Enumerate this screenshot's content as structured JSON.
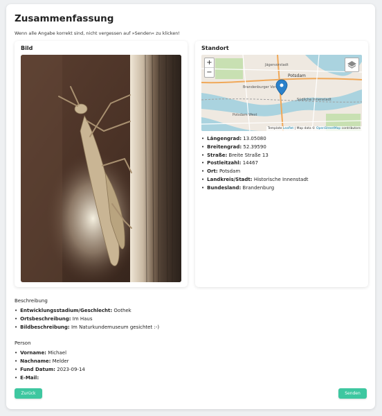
{
  "page": {
    "title": "Zusammenfassung",
    "subtitle": "Wenn alle Angabe korrekt sind, nicht vergessen auf »Senden« zu klicken!"
  },
  "image_card": {
    "title": "Bild"
  },
  "location_card": {
    "title": "Standort",
    "map": {
      "zoom_in": "+",
      "zoom_out": "−",
      "attribution_prefix": "Template",
      "attribution_leaflet": "Leaflet",
      "attribution_sep": " | Map data © ",
      "attribution_osm": "OpenStreetMap",
      "attribution_suffix": " contributors",
      "labels": [
        "Jägervorstadt",
        "Potsdam",
        "Brandenburger Vorstadt",
        "Potsdam West",
        "Südliche Innenstadt"
      ]
    },
    "fields": [
      {
        "label": "Längengrad:",
        "value": "13.05080"
      },
      {
        "label": "Breitengrad:",
        "value": "52.39590"
      },
      {
        "label": "Straße:",
        "value": "Breite Straße 13"
      },
      {
        "label": "Postleitzahl:",
        "value": "14467"
      },
      {
        "label": "Ort:",
        "value": "Potsdam"
      },
      {
        "label": "Landkreis/Stadt:",
        "value": "Historische Innenstadt"
      },
      {
        "label": "Bundesland:",
        "value": "Brandenburg"
      }
    ]
  },
  "description": {
    "title": "Beschreibung",
    "fields": [
      {
        "label": "Entwicklungsstadium/Geschlecht:",
        "value": "Oothek"
      },
      {
        "label": "Ortsbeschreibung:",
        "value": "Im Haus"
      },
      {
        "label": "Bildbeschreibung:",
        "value": "Im Naturkundemuseum gesichtet :-)"
      }
    ]
  },
  "person": {
    "title": "Person",
    "fields": [
      {
        "label": "Vorname:",
        "value": "Michael"
      },
      {
        "label": "Nachname:",
        "value": "Melder"
      },
      {
        "label": "Fund Datum:",
        "value": "2023-09-14"
      },
      {
        "label": "E-Mail:",
        "value": ""
      }
    ]
  },
  "buttons": {
    "back": "Zurück",
    "send": "Senden"
  },
  "colors": {
    "accent": "#3ec7a0",
    "map_water": "#aad3df",
    "map_marker": "#2a81cb"
  }
}
